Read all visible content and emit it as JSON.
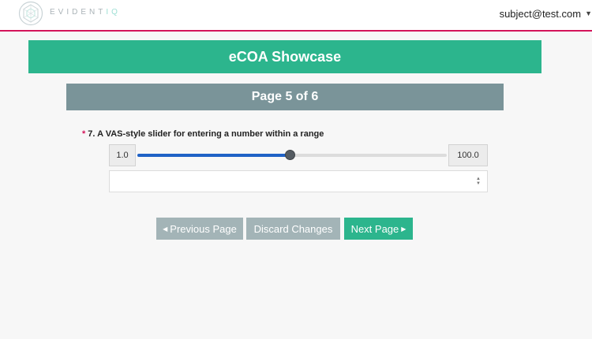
{
  "header": {
    "logo_text_main": "EVIDENT",
    "logo_text_accent": "IQ",
    "user_email": "subject@test.com",
    "user_caret_icon": "caret-down-icon"
  },
  "survey": {
    "title": "eCOA Showcase",
    "page_indicator": "Page 5 of 6"
  },
  "question": {
    "required_marker": "*",
    "number_text": "7. A VAS-style slider for entering a number within a range",
    "slider": {
      "min_label": "1.0",
      "max_label": "100.0",
      "min": 1.0,
      "max": 100.0,
      "value": 50.0
    },
    "value_input": {
      "value": "",
      "spinner_icon": "spinner-arrows-icon"
    }
  },
  "buttons": {
    "previous_label": "Previous Page",
    "discard_label": "Discard Changes",
    "next_label": "Next Page"
  },
  "colors": {
    "accent_green": "#2cb58d",
    "page_bar": "#7a9499",
    "disabled_button": "#a3b4b7",
    "brand_line": "#d4145a",
    "slider_fill": "#1f62c6"
  }
}
